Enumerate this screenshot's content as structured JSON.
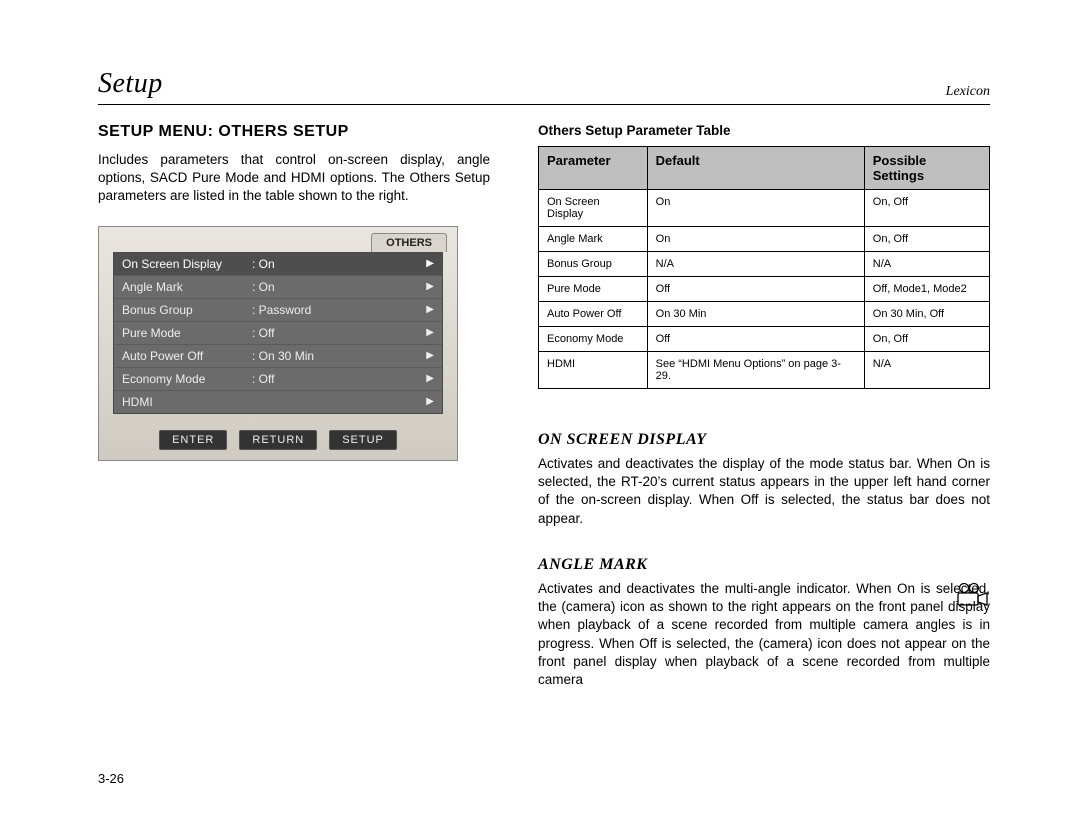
{
  "header": {
    "left": "Setup",
    "right": "Lexicon"
  },
  "section_title": "SETUP MENU: OTHERS SETUP",
  "intro": "Includes parameters that control on-screen display, angle options, SACD Pure Mode and HDMI options. The Others Setup parameters are listed in the table shown to the right.",
  "osd": {
    "tab": "OTHERS",
    "rows": [
      {
        "name": "On Screen Display",
        "value": "On",
        "selected": true
      },
      {
        "name": "Angle Mark",
        "value": "On",
        "selected": false
      },
      {
        "name": "Bonus Group",
        "value": "Password",
        "selected": false
      },
      {
        "name": "Pure Mode",
        "value": "Off",
        "selected": false
      },
      {
        "name": "Auto Power Off",
        "value": "On 30 Min",
        "selected": false
      },
      {
        "name": "Economy Mode",
        "value": "Off",
        "selected": false
      },
      {
        "name": "HDMI",
        "value": "",
        "selected": false
      }
    ],
    "buttons": [
      "ENTER",
      "RETURN",
      "SETUP"
    ]
  },
  "table_caption": "Others Setup Parameter Table",
  "table_headers": [
    "Parameter",
    "Default",
    "Possible Settings"
  ],
  "table_rows": [
    [
      "On Screen Display",
      "On",
      "On, Off"
    ],
    [
      "Angle Mark",
      "On",
      "On, Off"
    ],
    [
      "Bonus Group",
      "N/A",
      "N/A"
    ],
    [
      "Pure Mode",
      "Off",
      "Off, Mode1, Mode2"
    ],
    [
      "Auto Power Off",
      "On 30 Min",
      "On 30 Min, Off"
    ],
    [
      "Economy Mode",
      "Off",
      "On, Off"
    ],
    [
      "HDMI",
      "See “HDMI Menu Options” on page 3-29.",
      "N/A"
    ]
  ],
  "osd_section": {
    "title": "ON SCREEN DISPLAY",
    "body": "Activates and deactivates the display of the mode status bar. When On is selected, the RT-20’s current status appears in the upper left hand corner of the on-screen display. When Off is selected, the status bar does not appear."
  },
  "angle_section": {
    "title": "ANGLE MARK",
    "body": "Activates and deactivates the multi-angle indicator. When On is selected, the (camera) icon as shown to the right appears on the front panel display when playback of a scene recorded from multiple camera angles is in progress. When Off is selected, the (camera) icon does not appear on the front panel display when playback of a scene recorded from multiple camera"
  },
  "page_number": "3-26"
}
